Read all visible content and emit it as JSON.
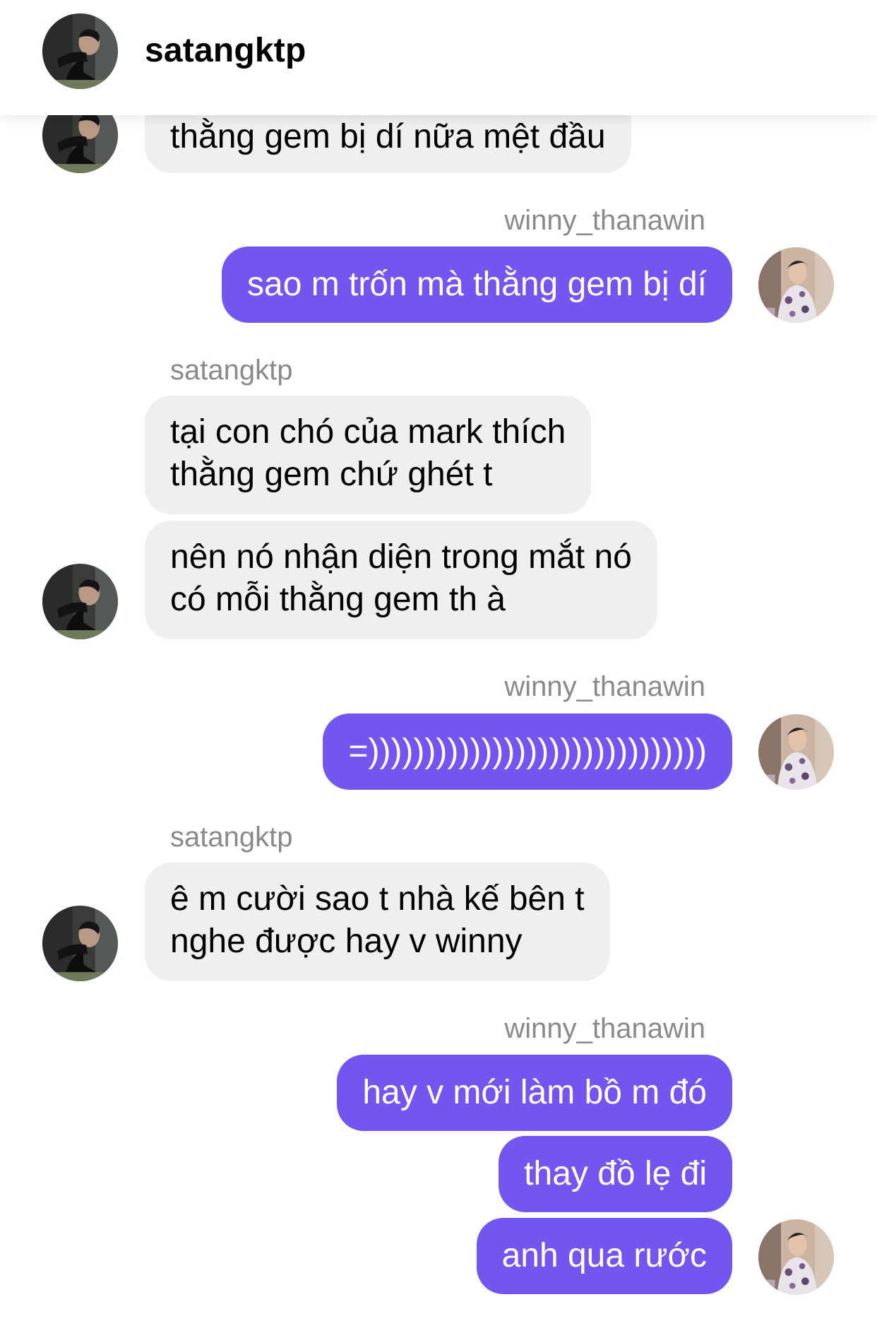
{
  "header": {
    "username": "satangktp",
    "avatar_icon": "profile-photo-satangktp"
  },
  "messages": [
    {
      "sender": "satangktp",
      "lines": [
        "thằng gem bị dí nữa mệt đầu"
      ]
    },
    {
      "sender": "winny_thanawin",
      "label": "winny_thanawin",
      "lines": [
        "sao m trốn mà thằng gem bị dí"
      ]
    },
    {
      "sender": "satangktp",
      "label": "satangktp",
      "lines": [
        "tại con chó của mark thích",
        "thằng gem chứ ghét t"
      ]
    },
    {
      "sender": "satangktp",
      "lines": [
        "nên nó nhận diện trong mắt nó",
        "có mỗi thằng gem th à"
      ]
    },
    {
      "sender": "winny_thanawin",
      "label": "winny_thanawin",
      "lines": [
        "=))))))))))))))))))))))))))))))"
      ]
    },
    {
      "sender": "satangktp",
      "label": "satangktp",
      "lines": [
        "ê m cười sao t nhà kế bên t",
        "nghe được hay v winny"
      ]
    },
    {
      "sender": "winny_thanawin",
      "label": "winny_thanawin",
      "lines": [
        "hay v mới làm bồ m đó"
      ]
    },
    {
      "sender": "winny_thanawin",
      "lines": [
        "thay đồ lẹ đi"
      ]
    },
    {
      "sender": "winny_thanawin",
      "lines": [
        "anh qua rước"
      ]
    }
  ],
  "colors": {
    "outgoing_bubble": "#7356f0",
    "incoming_bubble": "#efefef",
    "sender_label": "#8a8a8a"
  }
}
